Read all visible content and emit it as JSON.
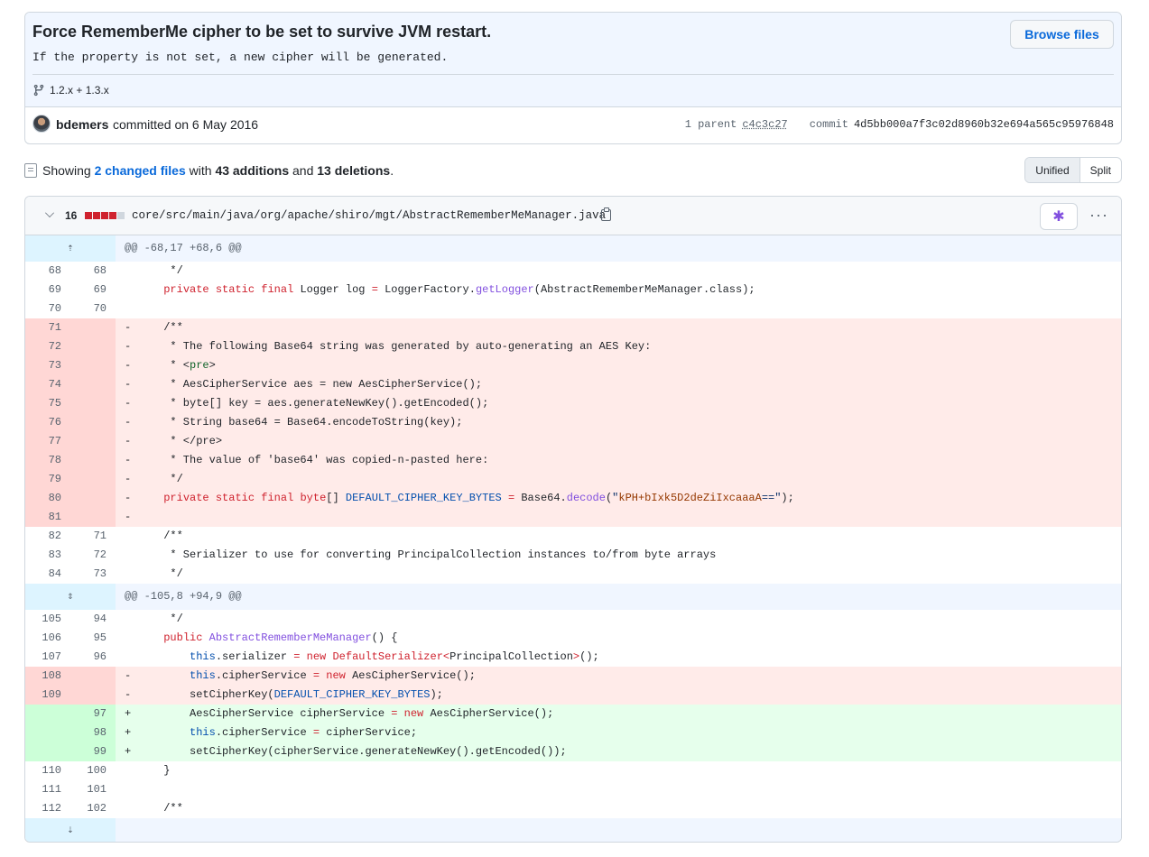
{
  "commit": {
    "title": "Force RememberMe cipher to be set to survive JVM restart.",
    "description": "If the property is not set, a new cipher will be generated.",
    "branches": "1.2.x + 1.3.x",
    "browse_label": "Browse files",
    "author": "bdemers",
    "committed_text": "committed on 6 May 2016",
    "parent_label": "1 parent",
    "parent_sha": "c4c3c27",
    "commit_label": "commit",
    "commit_sha": "4d5bb000a7f3c02d8960b32e694a565c95976848"
  },
  "summary": {
    "prefix": "Showing",
    "changed_files": "2 changed files",
    "with": "with",
    "additions": "43 additions",
    "and": "and",
    "deletions": "13 deletions",
    "period": ".",
    "unified_label": "Unified",
    "split_label": "Split"
  },
  "file": {
    "change_count": "16",
    "diffstat": {
      "deleted_blocks": 4,
      "neutral_blocks": 1
    },
    "path": "core/src/main/java/org/apache/shiro/mgt/AbstractRememberMeManager.java",
    "more_label": "···"
  },
  "diff": {
    "hunk1": "@@ -68,17 +68,6 @@",
    "hunk2": "@@ -105,8 +94,9 @@"
  },
  "colors": {
    "accent": "#0969da",
    "deletion_bg": "#ffebe9",
    "addition_bg": "#e6ffec",
    "hunk_bg": "#ddf4ff"
  },
  "icons": [
    "git-branch-icon",
    "avatar",
    "file-diff-icon",
    "chevron-down-icon",
    "copy-icon",
    "copilot-icon",
    "kebab-horizontal-icon",
    "unfold-icon",
    "fold-down-icon"
  ]
}
